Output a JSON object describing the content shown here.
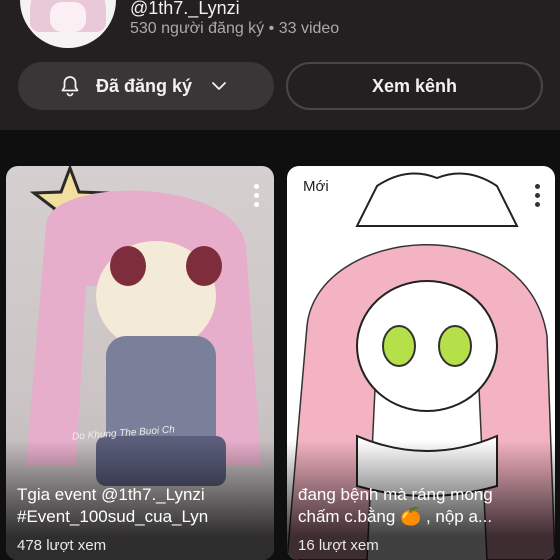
{
  "channel": {
    "handle": "@1th7._Lynzi",
    "subscribers": "530 người đăng ký",
    "separator": "•",
    "video_count": "33 video"
  },
  "buttons": {
    "subscribed_label": "Đã đăng ký",
    "view_channel_label": "Xem kênh"
  },
  "icons": {
    "bell": "bell-icon",
    "chevron": "chevron-down-icon",
    "more": "more-vert-icon"
  },
  "videos": [
    {
      "title_line1": "Tgia event @1th7._Lynzi",
      "title_line2": "#Event_100sud_cua_Lyn",
      "views": "478 lượt xem",
      "watermark": "Do Khung The Buoi Ch"
    },
    {
      "badge": "Mới",
      "title_line1": "đang bệnh mà ráng mong",
      "title_line2": "chấm c.bằng 🍊 , nộp a...",
      "views": "16 lượt xem"
    }
  ],
  "colors": {
    "background": "#0f0f0f",
    "header": "#241f21",
    "button_fill": "#3a3536",
    "accent_hair": "#e9a8bd",
    "accent_eye": "#b6e04a"
  }
}
